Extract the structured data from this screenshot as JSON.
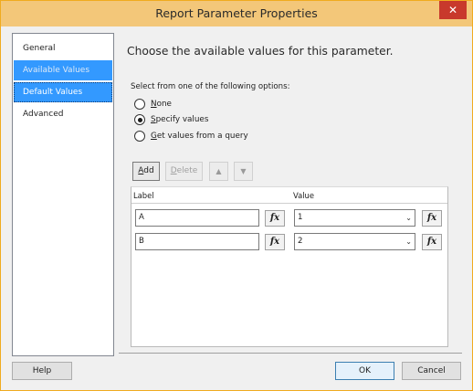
{
  "window": {
    "title": "Report Parameter Properties",
    "close_label": "✕"
  },
  "nav": {
    "items": [
      {
        "label": "General"
      },
      {
        "label": "Available Values"
      },
      {
        "label": "Default Values"
      },
      {
        "label": "Advanced"
      }
    ],
    "selected": "Available Values"
  },
  "content": {
    "heading": "Choose the available values for this parameter.",
    "options_prompt": "Select from one of the following options:",
    "options": [
      {
        "mnemonic": "N",
        "rest": "one",
        "selected": false
      },
      {
        "mnemonic": "S",
        "rest": "pecify values",
        "selected": true
      },
      {
        "mnemonic": "G",
        "rest": "et values from a query",
        "selected": false
      }
    ]
  },
  "toolbar": {
    "add_mnemonic": "A",
    "add_rest": "dd",
    "delete_mnemonic": "D",
    "delete_rest": "elete",
    "move_up_icon": "arrow-up-icon",
    "move_down_icon": "arrow-down-icon"
  },
  "grid": {
    "columns": [
      "Label",
      "Value"
    ],
    "fx_label": "fx",
    "rows": [
      {
        "label": "A",
        "value": "1"
      },
      {
        "label": "B",
        "value": "2"
      }
    ]
  },
  "footer": {
    "help": "Help",
    "ok": "OK",
    "cancel": "Cancel"
  },
  "colors": {
    "selection": "#3399ff",
    "title_bar": "#f3c779",
    "close_button": "#c8392c"
  }
}
